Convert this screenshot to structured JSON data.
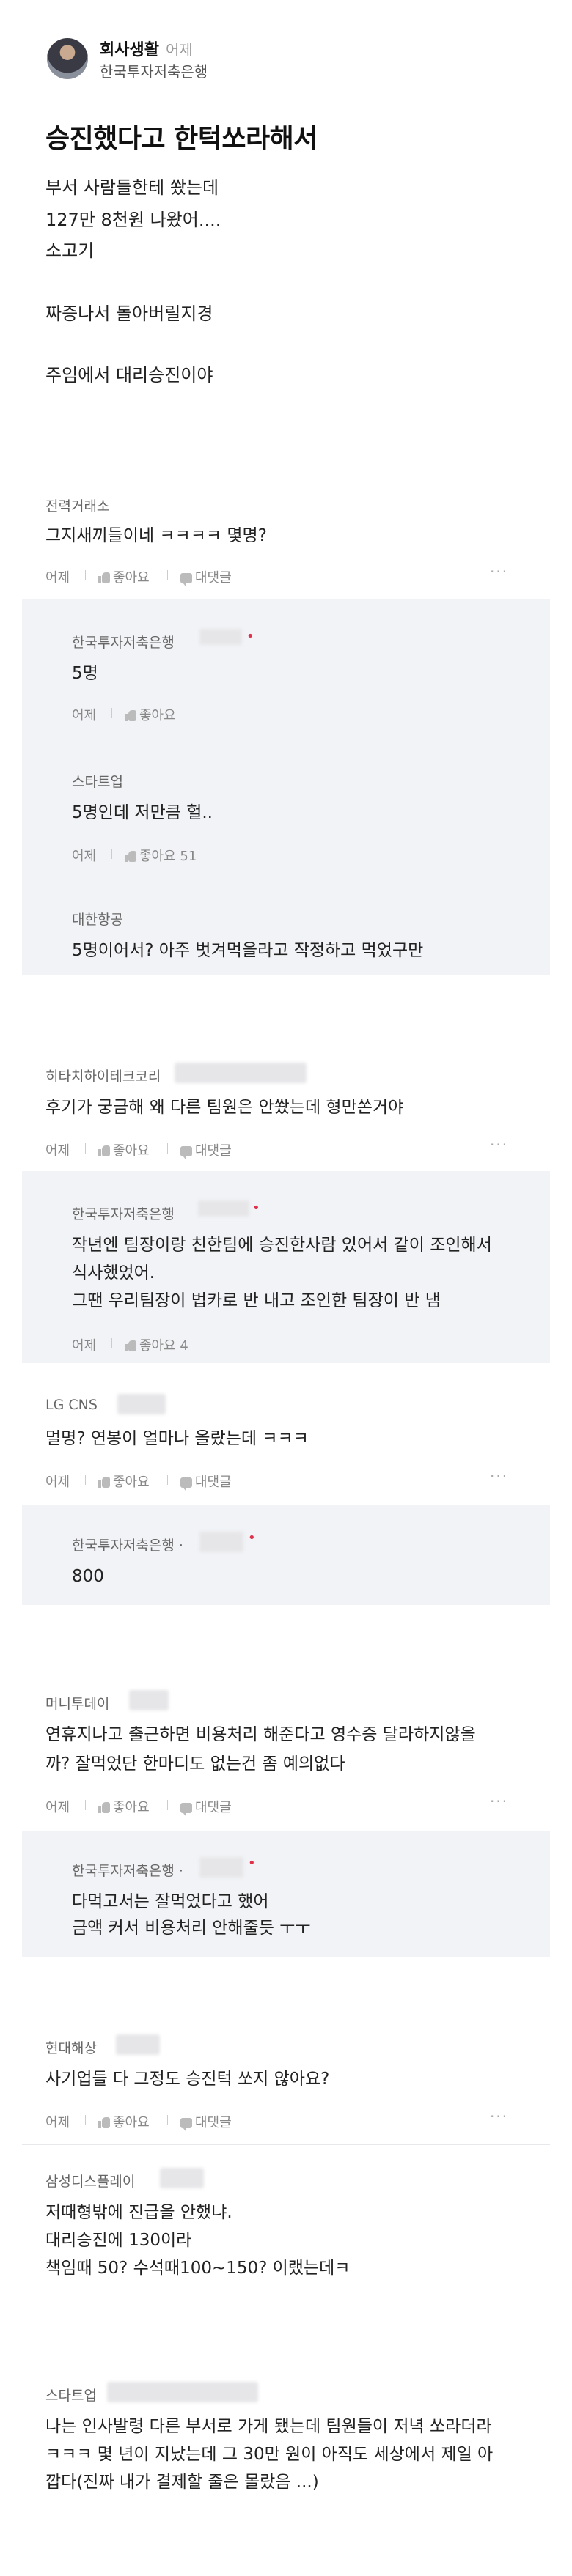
{
  "header": {
    "author": "회사생활",
    "time": "어제",
    "company": "한국투자저축은행"
  },
  "post": {
    "title": "승진했다고 한턱쏘라해서",
    "lines": [
      "부서 사람들한테 쐈는데",
      "127만 8천원 나왔어....",
      "소고기",
      "짜증나서 돌아버릴지경",
      "주임에서 대리승진이야"
    ]
  },
  "labels": {
    "like": "좋아요",
    "reply": "대댓글",
    "more": "···"
  },
  "comments": [
    {
      "company": "전력거래소",
      "text": "그지새끼들이네 ㅋㅋㅋㅋ 몇명?",
      "time": "어제"
    },
    {
      "company": "한국투자저축은행",
      "text": "5명",
      "time": "어제"
    },
    {
      "company": "스타트업",
      "text": "5명인데 저만큼 헐..",
      "time": "어제",
      "likes": "51"
    },
    {
      "company": "대한항공",
      "text": "5명이어서? 아주 벗겨먹을라고 작정하고 먹었구만"
    },
    {
      "company": "히타치하이테크코리",
      "text": "후기가 궁금해 왜 다른 팀원은 안쐈는데 형만쏜거야",
      "time": "어제"
    },
    {
      "company": "한국투자저축은행",
      "lines": [
        "작년엔 팀장이랑 친한팀에 승진한사람 있어서 같이 조인해서",
        "식사했었어.",
        "그땐 우리팀장이 법카로 반 내고 조인한 팀장이 반 냄"
      ],
      "time": "어제",
      "likes": "4"
    },
    {
      "company": "LG CNS",
      "text": "멀명? 연봉이 얼마나 올랐는데 ㅋㅋㅋ",
      "time": "어제"
    },
    {
      "company": "한국투자저축은행 ·",
      "text": "800"
    },
    {
      "company": "머니투데이",
      "lines": [
        "연휴지나고 출근하면 비용처리 해준다고 영수증 달라하지않을",
        "까? 잘먹었단 한마디도 없는건 좀 예의없다"
      ],
      "time": "어제"
    },
    {
      "company": "한국투자저축은행 ·",
      "lines": [
        "다먹고서는 잘먹었다고 했어",
        "금액 커서 비용처리 안해줄듯 ㅜㅜ"
      ]
    },
    {
      "company": "현대해상",
      "text": "사기업들 다 그정도 승진턱 쏘지 않아요?",
      "time": "어제"
    },
    {
      "company": "삼성디스플레이",
      "lines": [
        "저때형밖에 진급을 안했냐.",
        "대리승진에 130이라",
        "책임때 50? 수석때100~150? 이랬는데ㅋ"
      ]
    },
    {
      "company": "스타트업",
      "lines": [
        "나는 인사발령 다른 부서로 가게 됐는데 팀원들이 저녁 쏘라더라",
        "ㅋㅋㅋ 몇 년이 지났는데 그 30만 원이 아직도 세상에서 제일 아",
        "깝다(진짜 내가 결제할 줄은 몰랐음 ...)"
      ]
    }
  ]
}
